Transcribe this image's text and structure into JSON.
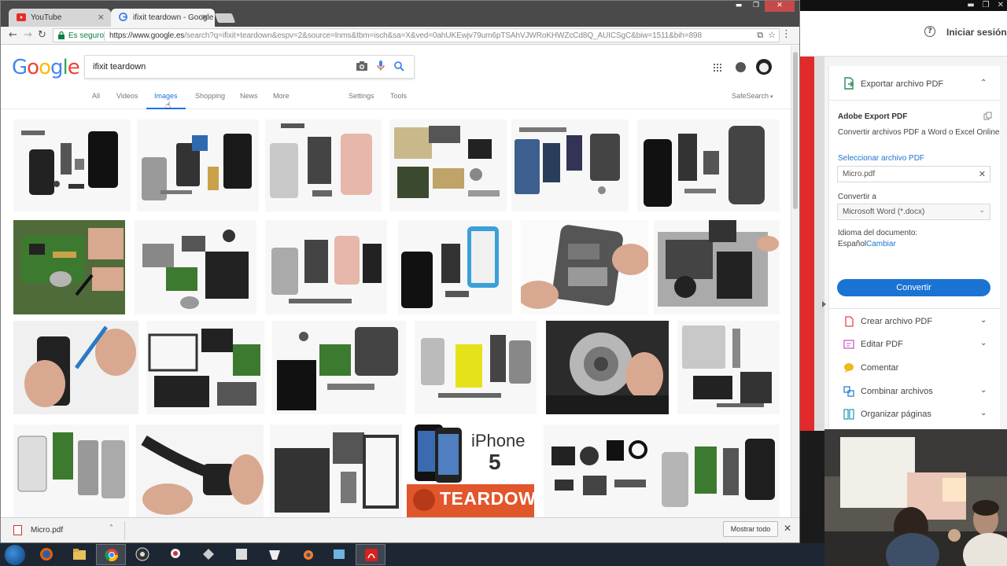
{
  "browser": {
    "tabs": [
      {
        "label": "YouTube",
        "favicon": "youtube-icon"
      },
      {
        "label": "ifixit teardown - Google",
        "favicon": "google-icon"
      }
    ],
    "address": {
      "secure_label": "Es seguro",
      "url_host": "https://www.google.es",
      "url_path": "/search?q=ifixit+teardown&espv=2&source=lnms&tbm=isch&sa=X&ved=0ahUKEwjv79um6pTSAhVJWRoKHWZcCd8Q_AUICSgC&biw=1511&bih=898"
    }
  },
  "google": {
    "logo": "Google",
    "query": "ifixit teardown",
    "tabs": [
      "All",
      "Videos",
      "Images",
      "Shopping",
      "News",
      "More"
    ],
    "active_tab": "Images",
    "settings": "Settings",
    "tools": "Tools",
    "safesearch": "SafeSearch"
  },
  "thumbnail_captions": {
    "iphone5_title": "iPhone",
    "iphone5_number": "5",
    "teardown_banner": "TEARDOWN"
  },
  "downloads": {
    "file": "Micro.pdf",
    "show_all": "Mostrar todo"
  },
  "acrobat": {
    "signin": "Iniciar sesión",
    "panel_title": "Exportar archivo PDF",
    "export_heading": "Adobe Export PDF",
    "export_desc": "Convertir archivos PDF a Word o Excel Online",
    "select_label": "Seleccionar archivo PDF",
    "selected_file": "Micro.pdf",
    "convert_to_label": "Convertir a",
    "convert_to_value": "Microsoft Word (*.docx)",
    "language_label": "Idioma del documento:",
    "language_value": "Español",
    "change_link": "Cambiar",
    "convert_button": "Convertir",
    "tools": [
      "Crear archivo PDF",
      "Editar PDF",
      "Comentar",
      "Combinar archivos",
      "Organizar páginas"
    ]
  },
  "colors": {
    "google_blue": "#4285f4",
    "google_red": "#ea4335",
    "google_yellow": "#fbbc05",
    "google_green": "#34a853",
    "acrobat_button": "#1b73d3",
    "teardown_orange": "#e2562b"
  }
}
